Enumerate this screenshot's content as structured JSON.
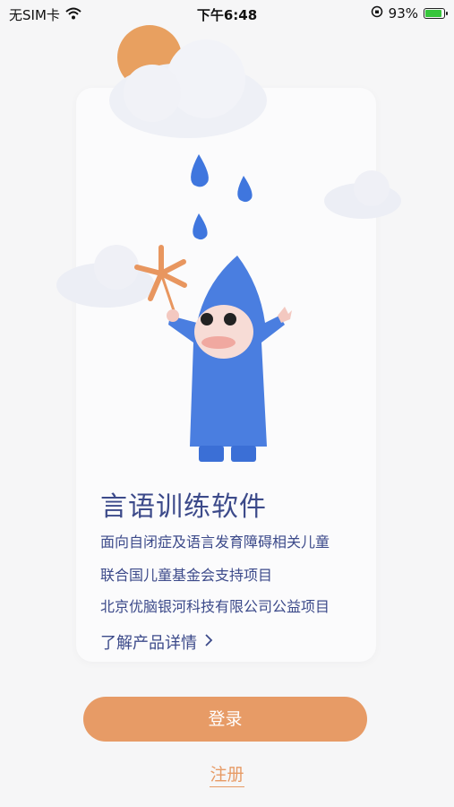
{
  "status_bar": {
    "carrier": "无SIM卡",
    "time": "下午6:48",
    "battery_percent": "93%",
    "battery_level": 0.93
  },
  "card": {
    "title": "言语训练软件",
    "lines": [
      "面向自闭症及语言发育障碍相关儿童",
      "联合国儿童基金会支持项目",
      "北京优脑银河科技有限公司公益项目"
    ],
    "learn_more": "了解产品详情"
  },
  "actions": {
    "login_label": "登录",
    "register_label": "注册"
  },
  "colors": {
    "accent": "#e79b66",
    "text_primary": "#3c4a8a",
    "raindrop": "#3f76de",
    "character_blue": "#4a7ee0",
    "sun": "#e8a060"
  }
}
